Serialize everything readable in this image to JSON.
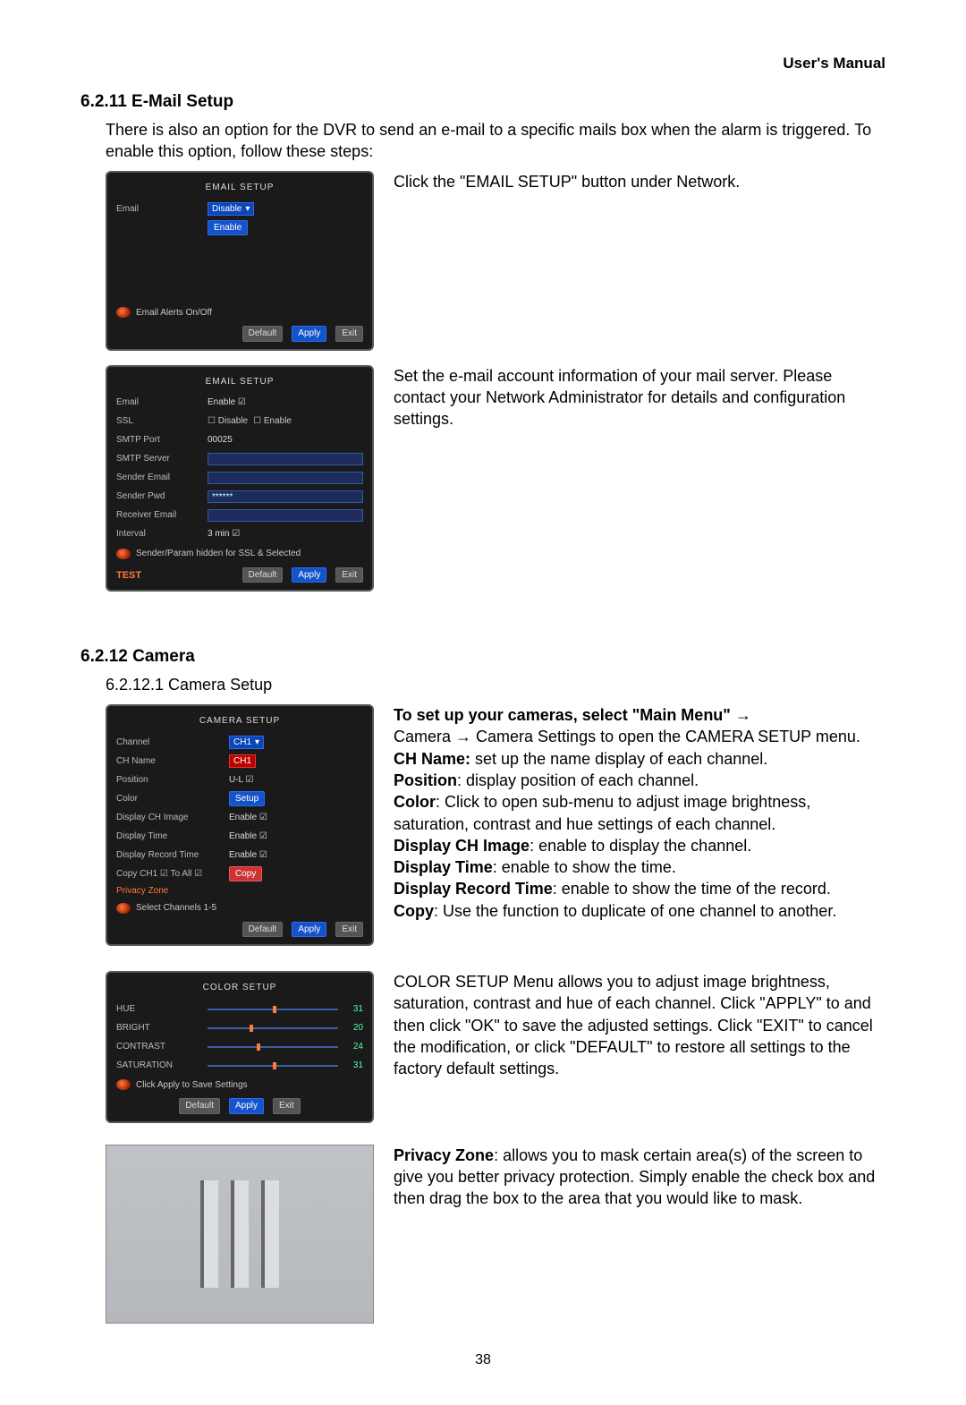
{
  "header": {
    "manual": "User's Manual"
  },
  "s6211": {
    "heading": "6.2.11 E-Mail Setup",
    "intro": "There is also an option for the DVR to send an e-mail to a specific mails box when the alarm is triggered.   To enable this option, follow these steps:",
    "desc1": "Click the \"EMAIL SETUP\" button under Network.",
    "desc2": "Set the e-mail account information of your mail server. Please contact your Network Administrator for details and configuration settings.",
    "panel1": {
      "title": "EMAIL SETUP",
      "email_label": "Email",
      "disable": "Disable",
      "enable_opt": "Enable",
      "hint": "Email Alerts On/Off",
      "default": "Default",
      "apply": "Apply",
      "exit": "Exit"
    },
    "panel2": {
      "title": "EMAIL SETUP",
      "email_label": "Email",
      "email_val": "Enable",
      "ssl_label": "SSL",
      "ssl_disable": "Disable",
      "ssl_enable": "Enable",
      "smtp_port_label": "SMTP Port",
      "smtp_port_val": "00025",
      "smtp_srv_label": "SMTP Server",
      "sender_email_label": "Sender Email",
      "sender_pwd_label": "Sender Pwd",
      "sender_pwd_val": "******",
      "receiver_email_label": "Receiver Email",
      "interval_label": "Interval",
      "interval_val": "3 min",
      "param_hint": "Sender/Param hidden for SSL & Selected",
      "test": "TEST",
      "default": "Default",
      "apply": "Apply",
      "exit": "Exit"
    }
  },
  "s6212": {
    "heading": "6.2.12 Camera",
    "sub": "6.2.12.1 Camera Setup",
    "panel": {
      "title": "CAMERA SETUP",
      "channel_label": "Channel",
      "channel_val": "CH1",
      "chname_label": "CH Name",
      "chname_val": "CH1",
      "position_label": "Position",
      "position_val": "U-L",
      "color_label": "Color",
      "color_btn": "Setup",
      "dispimg_label": "Display CH Image",
      "dispimg_val": "Enable",
      "disptime_label": "Display Time",
      "disptime_val": "Enable",
      "disprec_label": "Display Record Time",
      "disprec_val": "Enable",
      "copy_label": "Copy CH1",
      "copy_to": "To  All",
      "copy_btn": "Copy",
      "privzone": "Privacy Zone",
      "sel_hint": "Select Channels 1-5",
      "default": "Default",
      "apply": "Apply",
      "exit": "Exit"
    },
    "text": {
      "lead_bold": "To set up your cameras, select \"Main Menu\" ",
      "lead_rest": "Camera → Camera Settings to open the CAMERA SETUP menu.",
      "chname_b": "CH Name:",
      "chname_t": " set up the name display of each channel.",
      "pos_b": "Position",
      "pos_t": ": display position of each channel.",
      "color_b": "Color",
      "color_t": ": Click to open sub-menu to adjust image brightness, saturation, contrast and hue settings of each channel.",
      "dci_b": "Display CH Image",
      "dci_t": ": enable to display the channel.",
      "dt_b": "Display Time",
      "dt_t": ": enable to show the time.",
      "drt_b": "Display Record Time",
      "drt_t": ": enable to show the time of the record.",
      "copy_b": "Copy",
      "copy_t": ": Use the function to duplicate of one channel to another."
    },
    "color_panel": {
      "title": "COLOR SETUP",
      "hue": "HUE",
      "hue_v": "31",
      "bright": "BRIGHT",
      "bright_v": "20",
      "contrast": "CONTRAST",
      "contrast_v": "24",
      "sat": "SATURATION",
      "sat_v": "31",
      "hint": "Click Apply to Save Settings",
      "default": "Default",
      "apply": "Apply",
      "exit": "Exit"
    },
    "color_text": "COLOR SETUP Menu allows you to adjust image brightness, saturation, contrast and hue of each channel. Click \"APPLY\" to and then click \"OK\" to save the adjusted settings.   Click \"EXIT\" to cancel the modification, or click \"DEFAULT\" to restore all settings to the factory default settings.",
    "priv_b": "Privacy Zone",
    "priv_t": ": allows you to mask certain area(s) of the screen to give you better privacy protection.   Simply enable the check box and then drag the box to the area that you would like to mask."
  },
  "chart_data": {
    "type": "table",
    "title": "COLOR SETUP sliders",
    "categories": [
      "HUE",
      "BRIGHT",
      "CONTRAST",
      "SATURATION"
    ],
    "values": [
      31,
      20,
      24,
      31
    ],
    "range": [
      0,
      63
    ]
  },
  "page_number": "38"
}
